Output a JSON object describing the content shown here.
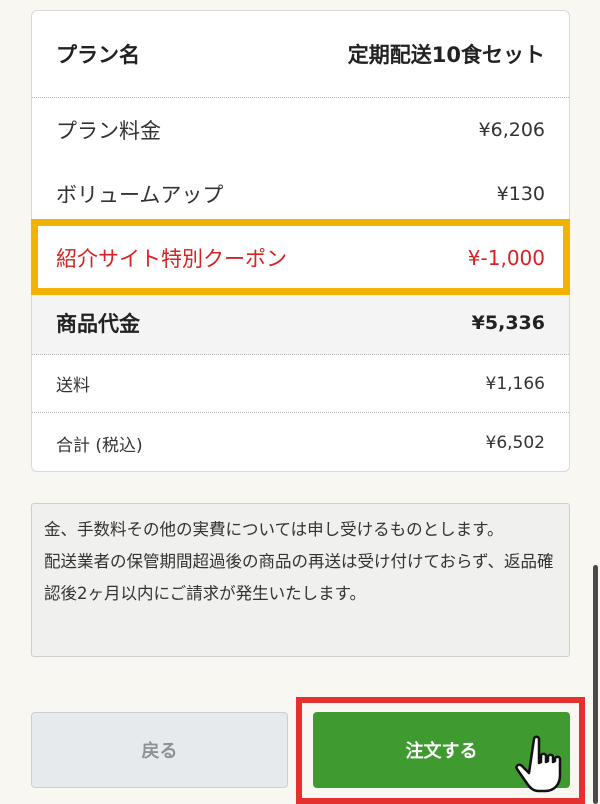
{
  "summary": {
    "plan_name_label": "プラン名",
    "plan_name_value": "定期配送10食セット",
    "plan_fee_label": "プラン料金",
    "plan_fee_value": "¥6,206",
    "volume_up_label": "ボリュームアップ",
    "volume_up_value": "¥130",
    "coupon_label": "紹介サイト特別クーポン",
    "coupon_value": "¥-1,000",
    "subtotal_label": "商品代金",
    "subtotal_value": "¥5,336",
    "shipping_label": "送料",
    "shipping_value": "¥1,166",
    "total_label": "合計 (税込)",
    "total_value": "¥6,502"
  },
  "notes": {
    "line1": "金、手数料その他の実費については申し受けるものとします。",
    "line2": "配送業者の保管期間超過後の商品の再送は受け付けておらず、返品確認後2ヶ月以内にご請求が発生いたします。"
  },
  "buttons": {
    "back_label": "戻る",
    "order_label": "注文する"
  },
  "colors": {
    "coupon_red": "#d62222",
    "highlight_yellow": "#f2b200",
    "order_green": "#3f9a2f",
    "highlight_red": "#e53030"
  }
}
